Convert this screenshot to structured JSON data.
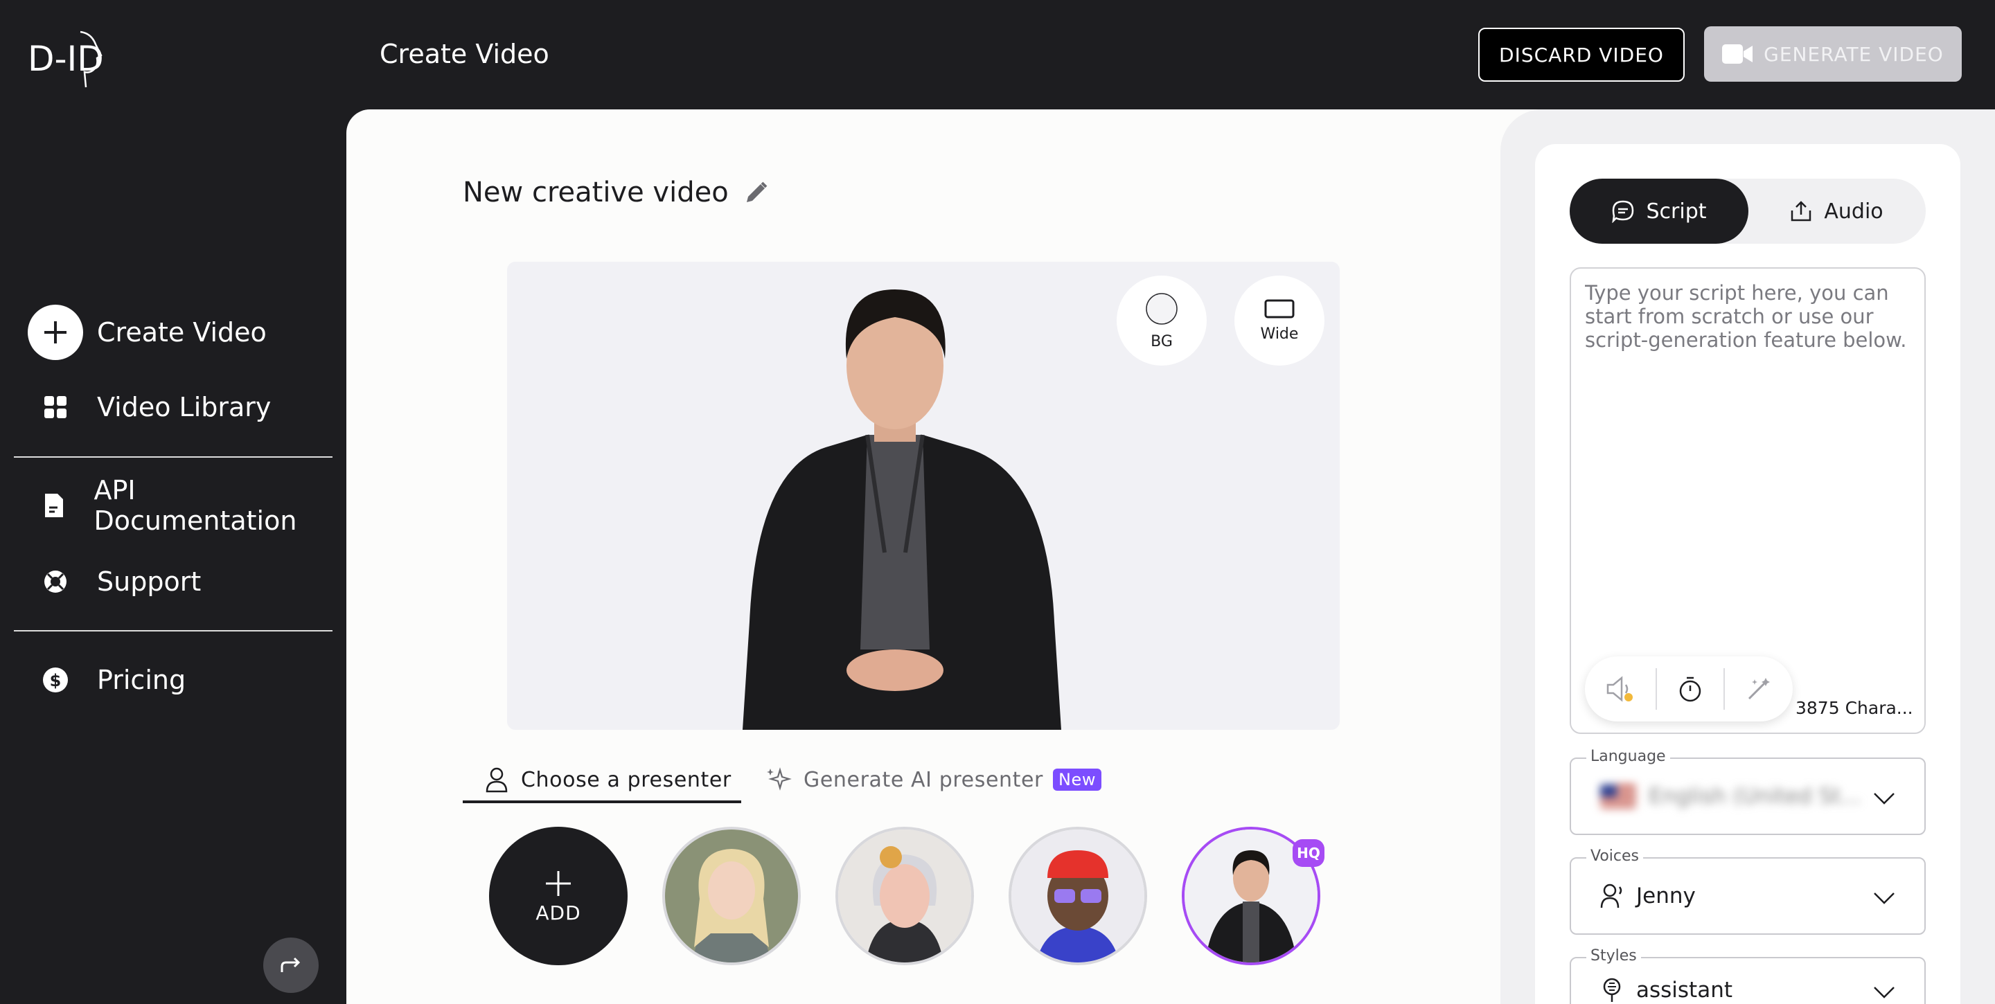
{
  "header": {
    "logo_text": "D-ID",
    "title": "Create Video",
    "discard_label": "DISCARD VIDEO",
    "generate_label": "GENERATE VIDEO"
  },
  "sidebar": {
    "items": [
      {
        "label": "Create Video",
        "icon": "plus-icon"
      },
      {
        "label": "Video Library",
        "icon": "grid-icon"
      },
      {
        "label": "API Documentation",
        "icon": "document-icon"
      },
      {
        "label": "Support",
        "icon": "lifebuoy-icon"
      },
      {
        "label": "Pricing",
        "icon": "dollar-icon"
      }
    ],
    "collapse_icon": "redo-arrow-icon"
  },
  "main": {
    "project_title": "New creative video",
    "tools": {
      "bg_label": "BG",
      "wide_label": "Wide"
    },
    "tabs": [
      {
        "label": "Choose a presenter",
        "active": true
      },
      {
        "label": "Generate AI presenter",
        "badge": "New",
        "active": false
      }
    ],
    "presenters": {
      "add_label": "ADD",
      "hq_badge": "HQ"
    }
  },
  "right_panel": {
    "segments": [
      {
        "label": "Script",
        "active": true
      },
      {
        "label": "Audio",
        "active": false
      }
    ],
    "script": {
      "placeholder": "Type your script here, you can start from scratch or use our script-generation feature below.",
      "char_count": "3875 Chara..."
    },
    "language": {
      "label": "Language",
      "value": "English (United St..."
    },
    "voices": {
      "label": "Voices",
      "value": "Jenny"
    },
    "styles": {
      "label": "Styles",
      "value": "assistant"
    }
  },
  "colors": {
    "sidebar_bg": "#1d1d20",
    "accent_purple": "#7c4dff",
    "hq_purple": "#a64bf4",
    "canvas_bg": "#fcfcfb"
  }
}
